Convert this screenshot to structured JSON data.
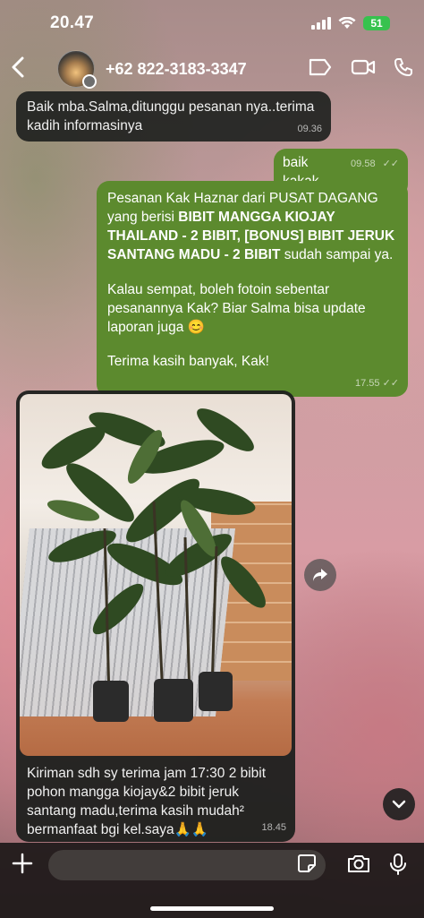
{
  "status_bar": {
    "time": "20.47",
    "battery": "51"
  },
  "header": {
    "back_icon": "chevron-left-icon",
    "contact_name": "+62 822-3183-3347",
    "actions": [
      "tag-icon",
      "video-call-icon",
      "phone-icon"
    ]
  },
  "messages": {
    "m1": {
      "text": "Baik mba.Salma,ditunggu pesanan nya..terima kadih informasinya",
      "time": "09.36"
    },
    "m2": {
      "text": "baik kakak",
      "time": "09.58",
      "ticks": "✓✓"
    },
    "m3": {
      "p1_a": "Pesanan Kak Haznar dari PUSAT DAGANG yang berisi ",
      "p1_bold": "BIBIT MANGGA KIOJAY THAILAND - 2 BIBIT, [BONUS] BIBIT JERUK SANTANG MADU - 2 BIBIT",
      "p1_b": " sudah sampai ya.",
      "p2": "Kalau sempat, boleh fotoin sebentar pesanannya Kak? Biar Salma bisa update laporan juga 😊",
      "p3": "Terima kasih banyak, Kak!",
      "time": "17.55",
      "ticks": "✓✓"
    },
    "m4": {
      "caption": "Kiriman sdh sy terima jam 17:30 2 bibit pohon mangga kiojay&2 bibit jeruk santang madu,terima kasih mudah² bermanfaat bgi kel.saya🙏🙏",
      "time": "18.45"
    }
  },
  "composer": {
    "placeholder": ""
  }
}
